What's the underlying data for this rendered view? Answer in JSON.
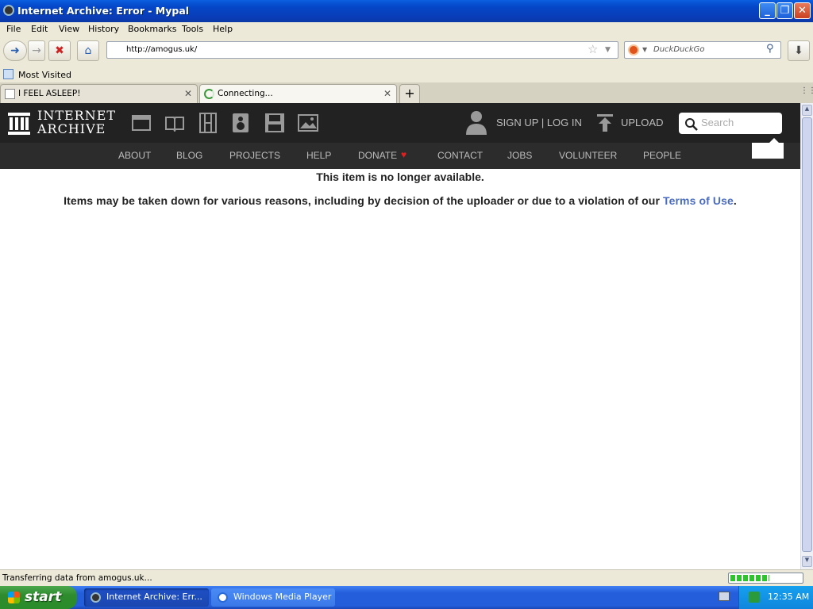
{
  "window": {
    "title": "Internet Archive: Error - Mypal"
  },
  "menu": [
    "File",
    "Edit",
    "View",
    "History",
    "Bookmarks",
    "Tools",
    "Help"
  ],
  "nav": {
    "url": "http://amogus.uk/",
    "search_placeholder": "DuckDuckGo"
  },
  "bookmarks": {
    "most_visited": "Most Visited"
  },
  "tabs": [
    {
      "label": "I FEEL ASLEEP!",
      "active": false
    },
    {
      "label": "Connecting...",
      "active": true
    }
  ],
  "ia": {
    "logo_line1": "INTERNET",
    "logo_line2": "ARCHIVE",
    "signup": "SIGN UP | LOG IN",
    "upload": "UPLOAD",
    "search_placeholder": "Search",
    "subnav": [
      "ABOUT",
      "BLOG",
      "PROJECTS",
      "HELP",
      "DONATE",
      "CONTACT",
      "JOBS",
      "VOLUNTEER",
      "PEOPLE"
    ]
  },
  "content": {
    "heading": "This item is no longer available.",
    "message_before": "Items may be taken down for various reasons, including by decision of the uploader or due to a violation of our ",
    "terms_link": "Terms of Use",
    "message_after": "."
  },
  "status": {
    "text": "Transferring data from amogus.uk...",
    "progress_fraction": 0.55
  },
  "taskbar": {
    "start": "start",
    "items": [
      "Internet Archive: Err...",
      "Windows Media Player"
    ],
    "clock": "12:35 AM"
  },
  "colors": {
    "xp_blue": "#0a3cb6",
    "ia_dark": "#222222",
    "link": "#4a6cc0",
    "donate_heart": "#e02020"
  }
}
